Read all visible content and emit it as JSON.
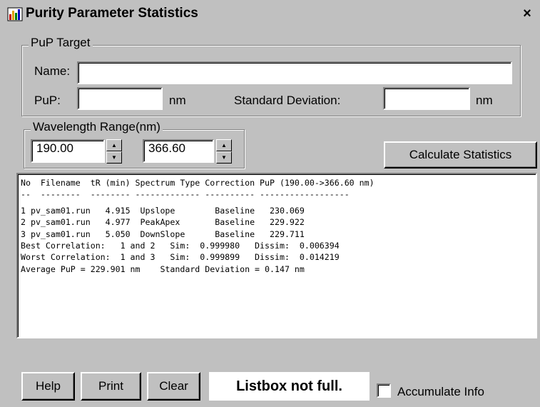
{
  "window": {
    "title": "Purity Parameter Statistics",
    "close_glyph": "×"
  },
  "pup_target": {
    "group_label": "PuP Target",
    "name_label": "Name:",
    "name_value": "",
    "pup_label": "PuP:",
    "pup_value": "",
    "pup_unit": "nm",
    "std_label": "Standard Deviation:",
    "std_value": "",
    "std_unit": "nm"
  },
  "wavelength": {
    "group_label": "Wavelength Range(nm)",
    "start": "190.00",
    "end": "366.60"
  },
  "calculate_label": "Calculate Statistics",
  "results": {
    "lines": [
      "No  Filename  tR (min) Spectrum Type Correction PuP (190.00->366.60 nm)",
      "--  --------  -------- ------------- ---------- ------------------",
      "1 pv_sam01.run   4.915  Upslope        Baseline   230.069",
      "2 pv_sam01.run   4.977  PeakApex       Baseline   229.922",
      "3 pv_sam01.run   5.050  DownSlope      Baseline   229.711",
      "Best Correlation:   1 and 2   Sim:  0.999980   Dissim:  0.006394",
      "Worst Correlation:  1 and 3   Sim:  0.999899   Dissim:  0.014219",
      "Average PuP = 229.901 nm    Standard Deviation = 0.147 nm"
    ]
  },
  "footer": {
    "help_label": "Help",
    "print_label": "Print",
    "clear_label": "Clear",
    "status_text": "Listbox not full.",
    "accumulate_label": "Accumulate Info",
    "accumulate_checked": false
  },
  "icons": {
    "app": "app-chart-icon",
    "close": "close-icon",
    "spin_up": "spin-up-icon",
    "spin_down": "spin-down-icon"
  }
}
